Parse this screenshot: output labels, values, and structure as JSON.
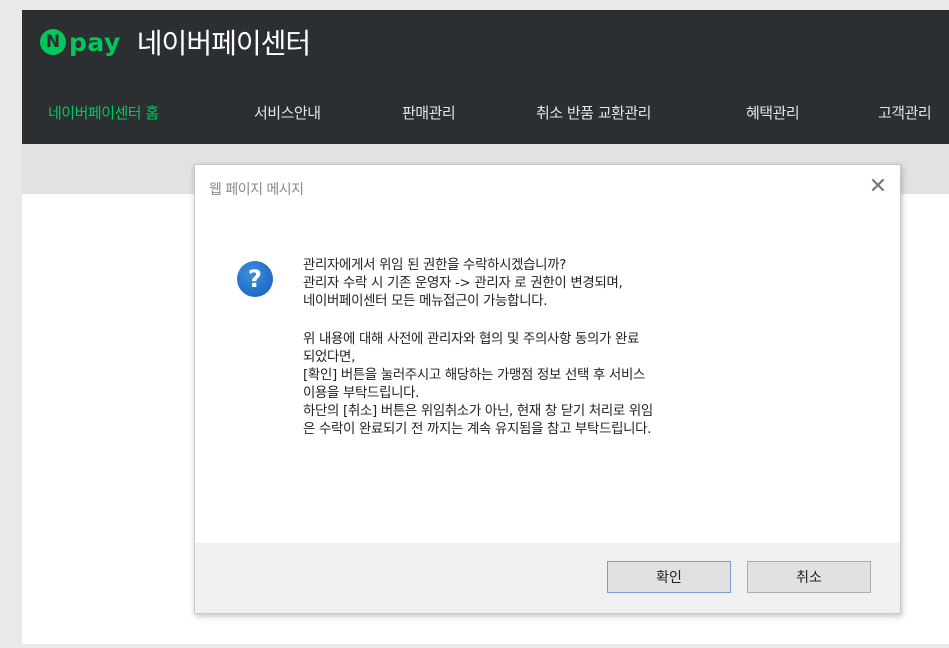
{
  "brand": {
    "logo_n": "N",
    "logo_pay": "pay",
    "title": "네이버페이센터"
  },
  "nav": {
    "items": [
      {
        "label": "네이버페이센터 홈",
        "active": true
      },
      {
        "label": "서비스안내"
      },
      {
        "label": "판매관리"
      },
      {
        "label": "취소 반품 교환관리"
      },
      {
        "label": "혜택관리"
      },
      {
        "label": "고객관리"
      }
    ]
  },
  "dialog": {
    "title": "웹 페이지 메시지",
    "close_icon": "✕",
    "question_icon": "?",
    "lines": [
      "관리자에게서 위임 된 권한을 수락하시겠습니까?",
      "관리자 수락 시 기존 운영자 -> 관리자 로 권한이 변경되며,",
      "네이버페이센터 모든 메뉴접근이 가능합니다."
    ],
    "lines2": [
      "위 내용에 대해 사전에 관리자와 협의 및 주의사항 동의가 완료",
      "되었다면,",
      "[확인] 버튼을 눌러주시고 해당하는 가맹점 정보 선택 후 서비스",
      "이용을 부탁드립니다.",
      "하단의 [취소] 버튼은 위임취소가 아닌, 현재 창 닫기 처리로 위임",
      "은 수락이 완료되기 전 까지는 계속 유지됨을 참고 부탁드립니다."
    ],
    "ok_label": "확인",
    "cancel_label": "취소"
  },
  "colors": {
    "accent": "#03c75a",
    "header_bg": "#2b2f32",
    "question_blue": "#1660b8"
  }
}
